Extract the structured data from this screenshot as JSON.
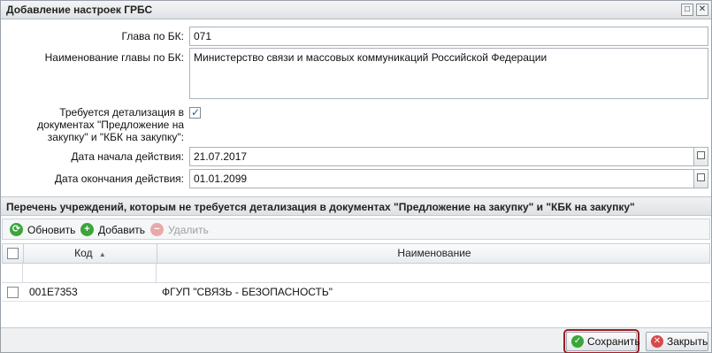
{
  "window": {
    "title": "Добавление настроек ГРБС",
    "buttons": {
      "maximize": "□",
      "close": "✕"
    }
  },
  "form": {
    "glava_label": "Глава по БК:",
    "glava_value": "071",
    "naim_label": "Наименование главы по БК:",
    "naim_value": "Министерство связи и массовых коммуникаций Российской Федерации",
    "detail_label_1": "Требуется детализация в",
    "detail_label_2": "документах \"Предложение на",
    "detail_label_3": "закупку\" и \"КБК на закупку\":",
    "detail_checked": true,
    "start_label": "Дата начала действия:",
    "start_value": "21.07.2017",
    "end_label": "Дата окончания действия:",
    "end_value": "01.01.2099"
  },
  "section": {
    "title": "Перечень учреждений, которым не требуется детализация в документах \"Предложение на закупку\" и \"КБК на закупку\""
  },
  "toolbar": {
    "refresh_label": "Обновить",
    "add_label": "Добавить",
    "delete_label": "Удалить"
  },
  "grid": {
    "columns": [
      "Код",
      "Наименование"
    ],
    "rows": [
      {
        "code": "001E7353",
        "name": "ФГУП \"СВЯЗЬ - БЕЗОПАСНОСТЬ\""
      }
    ]
  },
  "footer": {
    "save_label": "Сохранить",
    "close_label": "Закрыть"
  },
  "colors": {
    "accent_green": "#3aa63a",
    "accent_red": "#d94848",
    "highlight": "#9e1a24"
  }
}
